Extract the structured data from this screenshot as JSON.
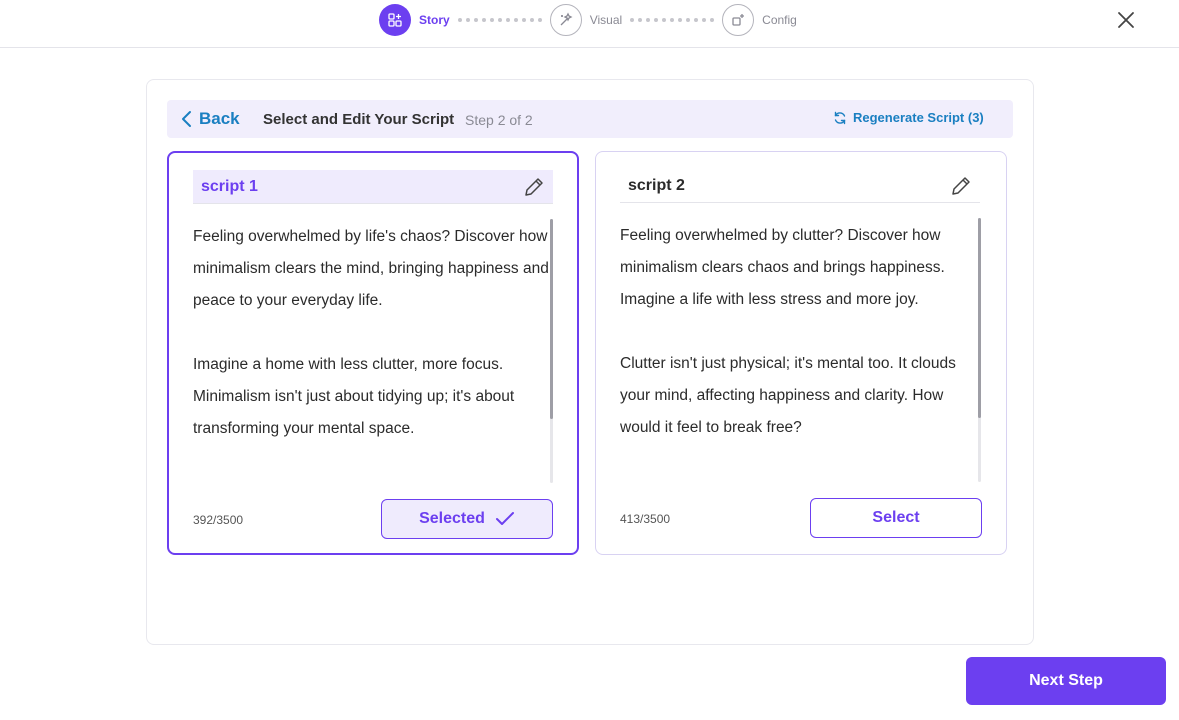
{
  "stepper": {
    "steps": [
      {
        "label": "Story",
        "state": "active"
      },
      {
        "label": "Visual",
        "state": "inactive"
      },
      {
        "label": "Config",
        "state": "inactive"
      }
    ]
  },
  "header": {
    "back_label": "Back",
    "title": "Select and Edit Your Script",
    "step_text": "Step 2 of 2",
    "regenerate_label": "Regenerate Script (3)"
  },
  "scripts": [
    {
      "title": "script 1",
      "paragraphs": [
        "Feeling overwhelmed by life's chaos? Discover how minimalism clears the mind, bringing happiness and peace to your everyday life.",
        "Imagine a home with less clutter, more focus. Minimalism isn't just about tidying up; it's about transforming your mental space."
      ],
      "count": "392/3500",
      "button_label": "Selected",
      "selected": true
    },
    {
      "title": "script 2",
      "paragraphs": [
        "Feeling overwhelmed by clutter? Discover how minimalism clears chaos and brings happiness. Imagine a life with less stress and more joy.",
        "Clutter isn't just physical; it's mental too. It clouds your mind, affecting happiness and clarity. How would it feel to break free?"
      ],
      "count": "413/3500",
      "button_label": "Select",
      "selected": false
    }
  ],
  "footer": {
    "next_label": "Next Step"
  },
  "colors": {
    "accent": "#6c3ff0",
    "link": "#1a7fc1",
    "header_bg": "#f1eefc"
  }
}
